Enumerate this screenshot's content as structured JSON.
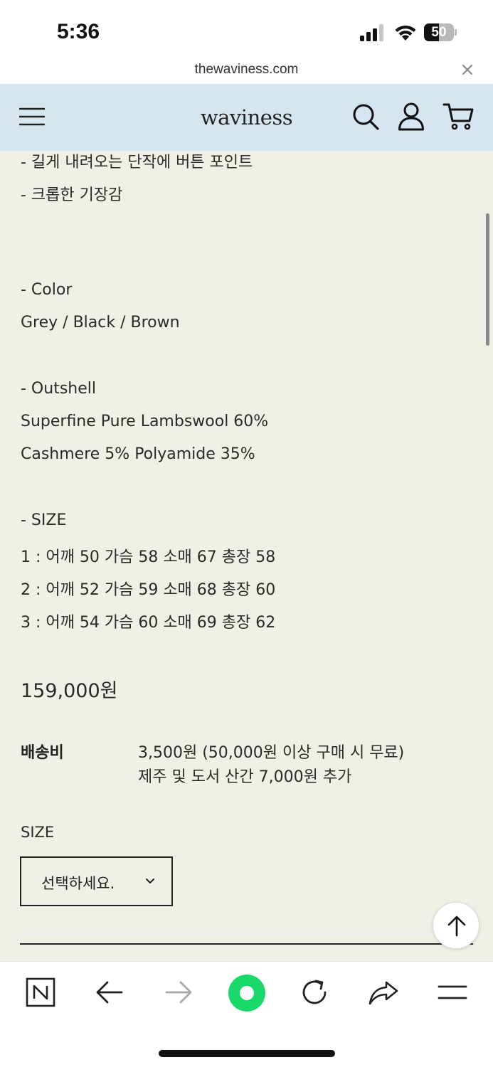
{
  "status_bar": {
    "time": "5:36",
    "battery_level": "50",
    "battery_fraction": 0.5
  },
  "browser": {
    "url": "thewaviness.com"
  },
  "header": {
    "logo": "waviness",
    "background_color": "#d6e6f0"
  },
  "description": {
    "lines": [
      "- 길게 내려오는 단작에 버튼 포인트",
      "- 크롭한 기장감",
      "- Color",
      "Grey / Black / Brown",
      "- Outshell",
      "Superfine Pure Lambswool 60%",
      "Cashmere 5% Polyamide 35%",
      "- SIZE",
      "1 : 어깨 50 가슴 58 소매 67 총장 58",
      "2 : 어깨 52 가슴 59 소매 68 총장 60",
      "3 : 어깨 54 가슴 60 소매 69 총장 62"
    ]
  },
  "product": {
    "price": "159,000원",
    "shipping_label": "배송비",
    "shipping_lines": [
      "3,500원 (50,000원 이상 구매 시 무료)",
      "제주 및 도서 산간 7,000원 추가"
    ],
    "size_label": "SIZE",
    "size_select_value": "선택하세요."
  },
  "icons": {
    "header": [
      "menu-icon",
      "search-icon",
      "user-icon",
      "cart-icon"
    ],
    "toolbar": [
      "naver-icon",
      "back-icon",
      "forward-icon",
      "green-dot-icon",
      "reload-icon",
      "share-icon",
      "menu-icon"
    ],
    "accent_green": "#19d96b",
    "page_background": "#f1f0e6"
  }
}
